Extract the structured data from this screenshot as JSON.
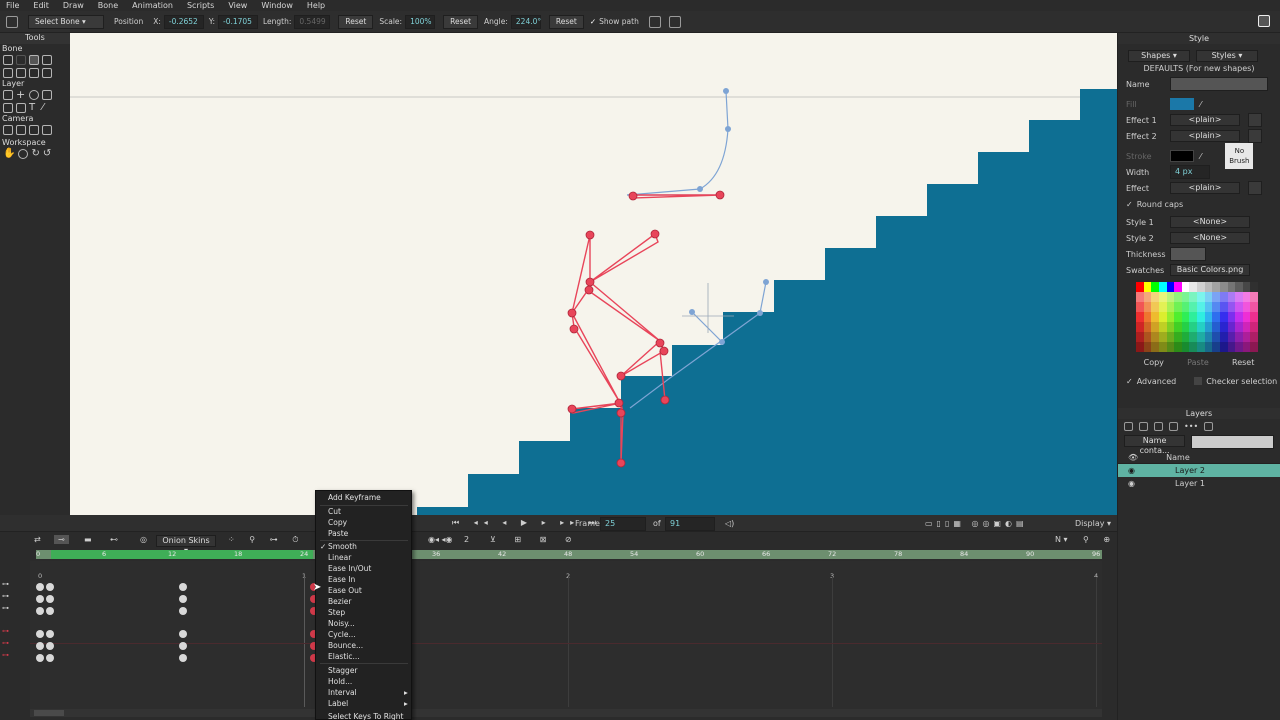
{
  "menubar": [
    "File",
    "Edit",
    "Draw",
    "Bone",
    "Animation",
    "Scripts",
    "View",
    "Window",
    "Help"
  ],
  "toolopts": {
    "mode": "Select Bone",
    "position_label": "Position",
    "x_label": "X:",
    "x_value": "-0.2652",
    "y_label": "Y:",
    "y_value": "-0.1705",
    "length_label": "Length:",
    "length_value": "0.5499",
    "reset1": "Reset",
    "scale_label": "Scale:",
    "scale_value": "100%",
    "reset2": "Reset",
    "angle_label": "Angle:",
    "angle_value": "224.0°",
    "reset3": "Reset",
    "show_path": "Show path"
  },
  "tools": {
    "title": "Tools",
    "bone": "Bone",
    "layer": "Layer",
    "camera": "Camera",
    "workspace": "Workspace"
  },
  "style": {
    "title": "Style",
    "shapes_tab": "Shapes",
    "styles_tab": "Styles",
    "defaults": "DEFAULTS (For new shapes)",
    "name_label": "Name",
    "fill_label": "Fill",
    "effect1_label": "Effect 1",
    "effect1_value": "<plain>",
    "effect2_label": "Effect 2",
    "effect2_value": "<plain>",
    "stroke_label": "Stroke",
    "no_brush": "No Brush",
    "width_label": "Width",
    "width_value": "4 px",
    "effect_label": "Effect",
    "effect_value": "<plain>",
    "round_caps": "Round caps",
    "style1_label": "Style 1",
    "style1_value": "<None>",
    "style2_label": "Style 2",
    "style2_value": "<None>",
    "thickness_label": "Thickness",
    "swatches_label": "Swatches",
    "swatches_value": "Basic Colors.png",
    "copy": "Copy",
    "paste": "Paste",
    "reset": "Reset",
    "advanced": "Advanced",
    "checker": "Checker selection",
    "fill_color": "#1b78a8",
    "stroke_color": "#000000"
  },
  "layers": {
    "title": "Layers",
    "filter": "Name conta...",
    "name_col": "Name",
    "items": [
      {
        "name": "Layer 2"
      },
      {
        "name": "Layer 1"
      }
    ]
  },
  "timeline": {
    "frame_label": "Frame",
    "frame_value": "25",
    "of_label": "of",
    "of_value": "91",
    "display": "Display",
    "onion": "Onion Skins",
    "n_label": "N",
    "count": "2"
  },
  "ruler": [
    "0",
    "6",
    "12",
    "18",
    "24",
    "30",
    "36",
    "42",
    "48",
    "54",
    "60",
    "66",
    "72",
    "78",
    "84",
    "90",
    "96"
  ],
  "secondary_ticks": [
    "0",
    "1",
    "2",
    "3",
    "4"
  ],
  "context_menu": {
    "items": [
      "Add Keyframe",
      "Cut",
      "Copy",
      "Paste",
      "Smooth",
      "Linear",
      "Ease In/Out",
      "Ease In",
      "Ease Out",
      "Bezier",
      "Step",
      "Noisy...",
      "Cycle...",
      "Bounce...",
      "Elastic...",
      "Stagger",
      "Hold...",
      "Interval",
      "Label",
      "Select Keys To Right"
    ],
    "checked": "Smooth"
  },
  "colors": {
    "stairs": "#0e6f93",
    "canvas": "#f6f4ec",
    "bone_red": "#e8455a",
    "bone_blue": "#7ea4d4",
    "accent": "#5fb3a3"
  }
}
